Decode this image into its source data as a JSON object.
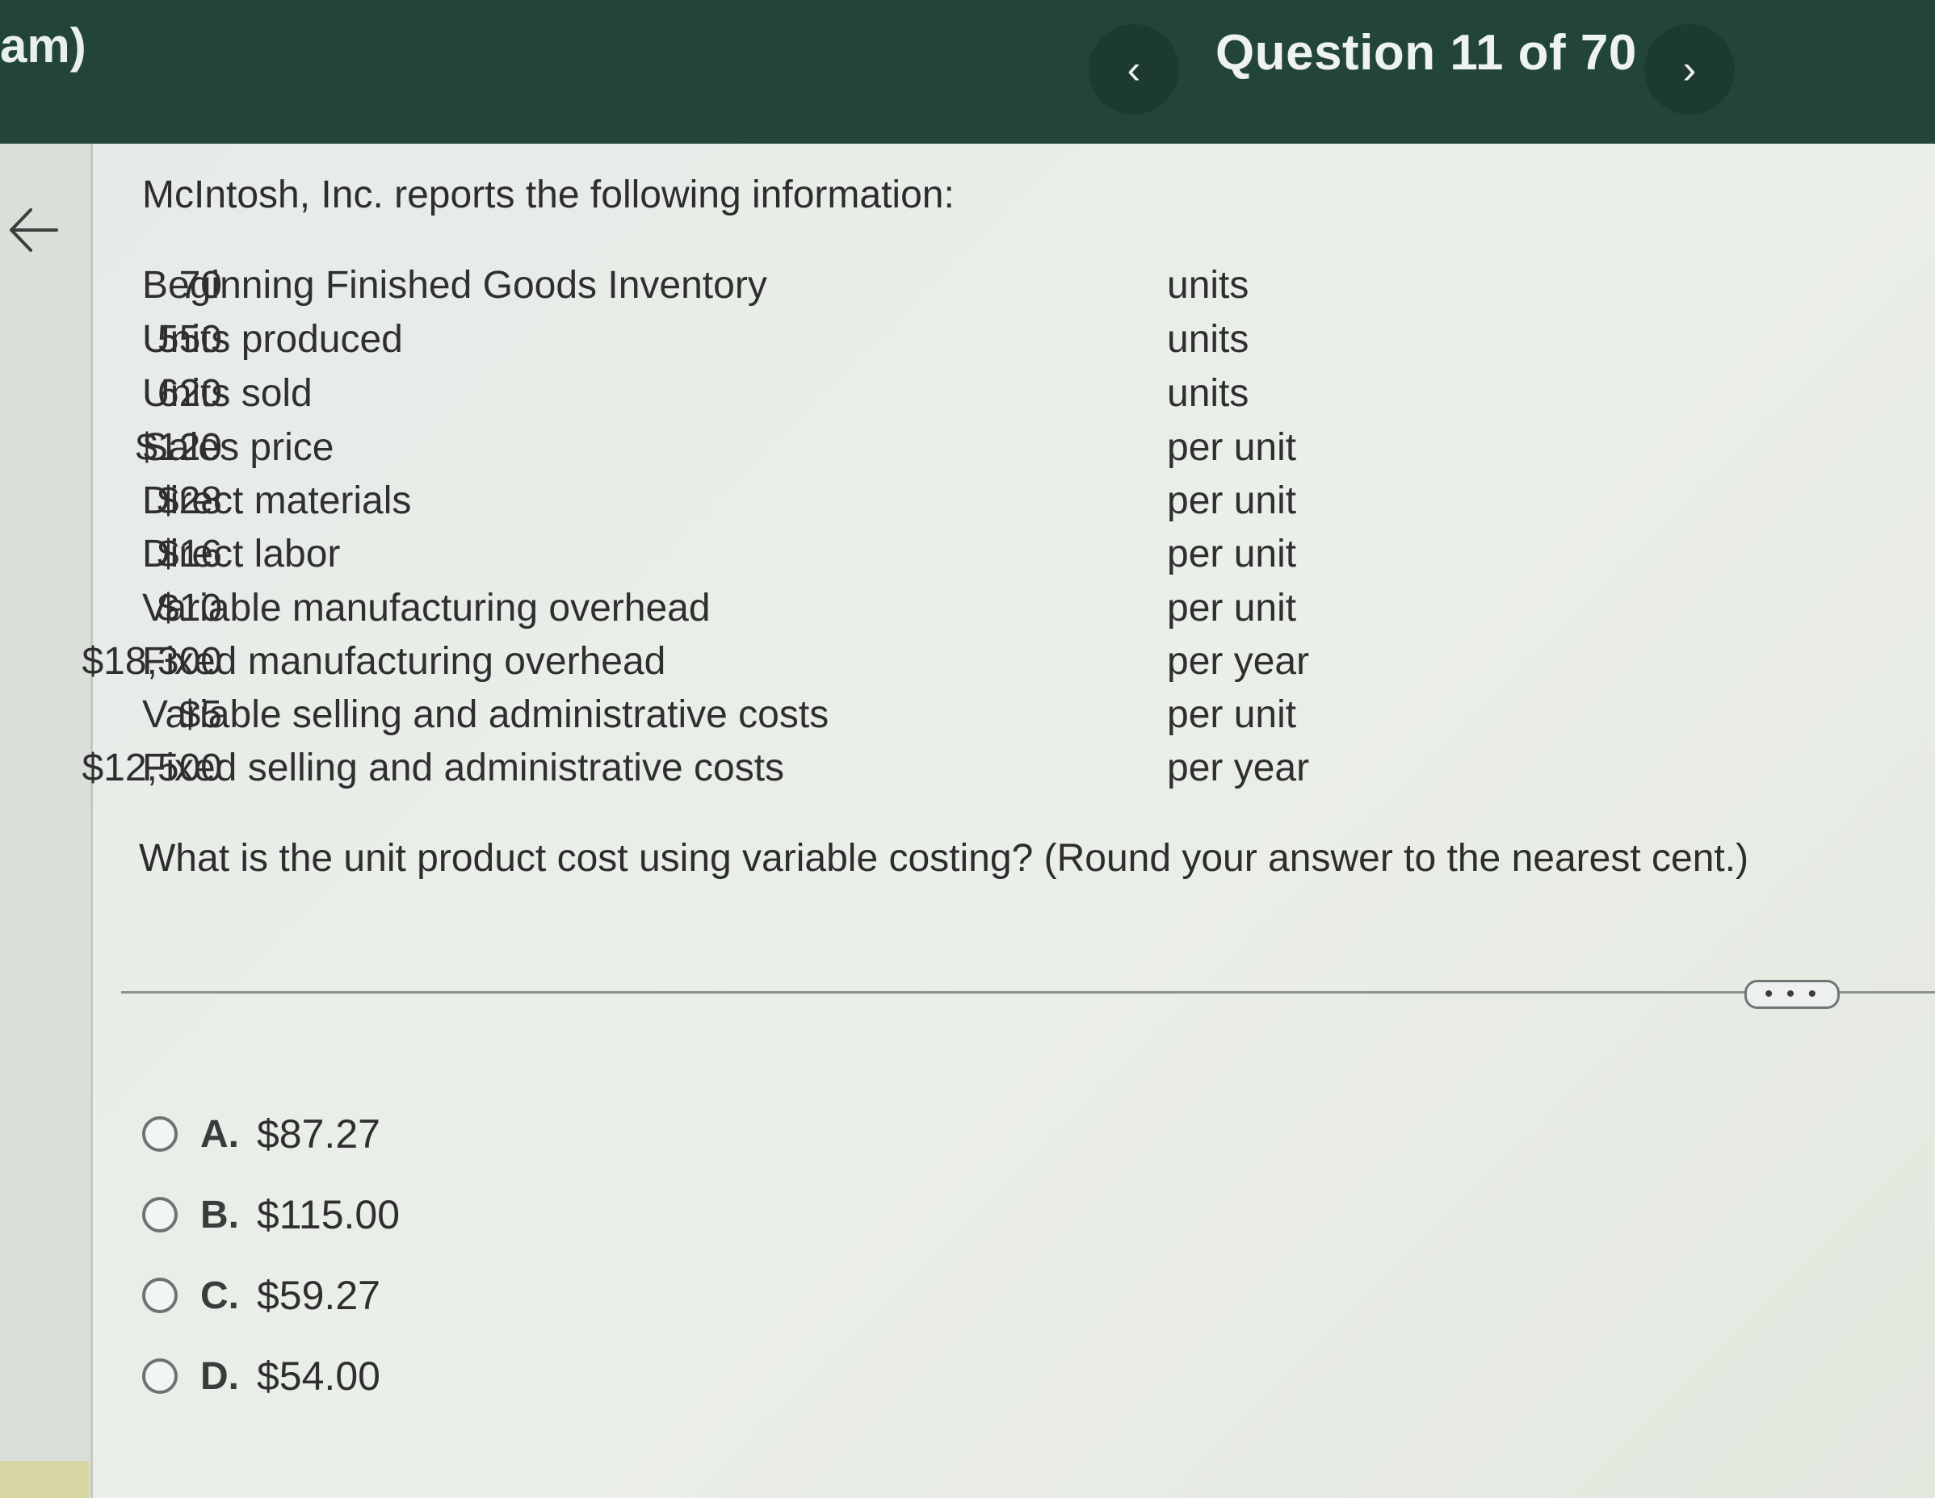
{
  "header": {
    "brand_fragment": "am)",
    "question_counter": "Question 11 of 70",
    "prev_symbol": "‹",
    "next_symbol": "›"
  },
  "problem": {
    "intro": "McIntosh, Inc. reports the following information:",
    "rows": [
      {
        "label": "Beginning Finished Goods Inventory",
        "value": "70",
        "unit": "units"
      },
      {
        "label": "Units produced",
        "value": "550",
        "unit": "units"
      },
      {
        "label": "Units sold",
        "value": "620",
        "unit": "units"
      },
      {
        "label": "Sales price",
        "value": "$120",
        "unit": "per unit"
      },
      {
        "label": "Direct materials",
        "value": "$28",
        "unit": "per unit"
      },
      {
        "label": "Direct labor",
        "value": "$16",
        "unit": "per unit"
      },
      {
        "label": "Variable manufacturing overhead",
        "value": "$10",
        "unit": "per unit"
      },
      {
        "label": "Fixed manufacturing overhead",
        "value": "$18,300",
        "unit": "per year"
      },
      {
        "label": "Variable selling and administrative costs",
        "value": "$5",
        "unit": "per unit"
      },
      {
        "label": "Fixed selling and administrative costs",
        "value": "$12,500",
        "unit": "per year"
      }
    ],
    "question": "What is the unit product cost using variable costing? (Round your answer to the nearest cent.)"
  },
  "more_button": "• • •",
  "choices": [
    {
      "letter": "A.",
      "text": "$87.27"
    },
    {
      "letter": "B.",
      "text": "$115.00"
    },
    {
      "letter": "C.",
      "text": "$59.27"
    },
    {
      "letter": "D.",
      "text": "$54.00"
    }
  ]
}
